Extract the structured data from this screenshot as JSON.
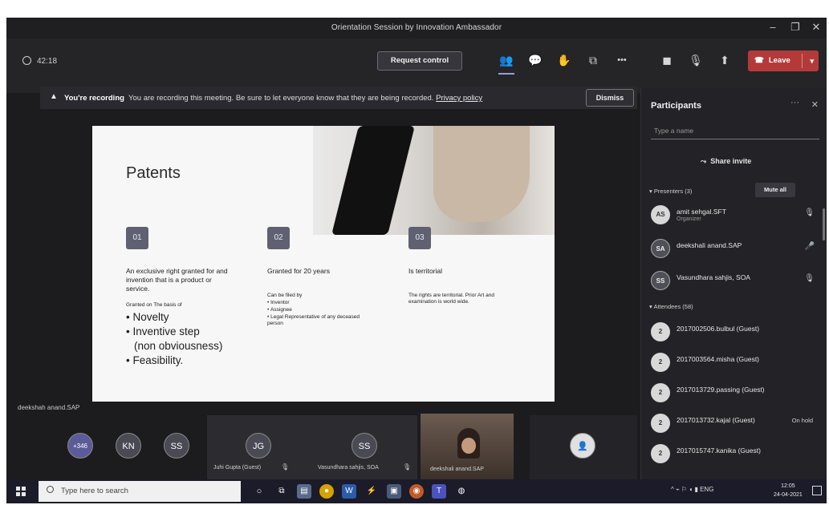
{
  "window": {
    "title": "Orientation Session by Innovation Ambassador"
  },
  "toolbar": {
    "timer": "42:18",
    "request_control": "Request control",
    "leave": "Leave",
    "more": "•••"
  },
  "banner": {
    "bold": "You're recording",
    "text": "You are recording this meeting. Be sure to let everyone know that they are being recorded.",
    "link": "Privacy policy",
    "dismiss": "Dismiss"
  },
  "slide": {
    "title": "Patents",
    "columns": [
      {
        "num": "01",
        "heading": "An exclusive right granted for and invention that is a product or service.",
        "sub": "Granted on The basis of",
        "bullets": [
          "Novelty",
          "Inventive step",
          "(non obviousness)",
          "Feasibility."
        ]
      },
      {
        "num": "02",
        "heading": "Granted for 20 years",
        "sub": "Can be filed by",
        "bullets": [
          "Inventor",
          "Assignee",
          "Legal Representative of any deceased person"
        ]
      },
      {
        "num": "03",
        "heading": "Is territorial",
        "sub": "The rights are territorial. Prior Art and examination is world wide.",
        "bullets": []
      }
    ]
  },
  "presenter_label": "deekshah anand.SAP",
  "strip": {
    "overflow": "+346",
    "avatars": [
      "KN",
      "SS"
    ],
    "tiles": [
      {
        "initials": "JG",
        "name": "Juhi Gupta (Guest)"
      },
      {
        "initials": "SS",
        "name": "Vasundhara sahjis, SOA"
      },
      {
        "name": "deekshali anand.SAP"
      }
    ]
  },
  "panel": {
    "title": "Participants",
    "search_placeholder": "Type a name",
    "share_invite": "Share invite",
    "presenters_head": "Presenters (3)",
    "mute_all": "Mute all",
    "attendees_head": "Attendees (58)",
    "presenters": [
      {
        "initials": "AS",
        "name": "amit sehgal.SFT",
        "role": "Organizer"
      },
      {
        "initials": "SA",
        "name": "deekshali anand.SAP",
        "role": ""
      },
      {
        "initials": "SS",
        "name": "Vasundhara sahjis, SOA",
        "role": ""
      }
    ],
    "attendees": [
      {
        "initials": "2",
        "name": "2017002506.bulbul (Guest)",
        "status": ""
      },
      {
        "initials": "2",
        "name": "2017003564.misha (Guest)",
        "status": ""
      },
      {
        "initials": "2",
        "name": "2017013729.passing (Guest)",
        "status": ""
      },
      {
        "initials": "2",
        "name": "2017013732.kajal (Guest)",
        "status": "On hold"
      },
      {
        "initials": "2",
        "name": "2017015747.kanika (Guest)",
        "status": ""
      }
    ]
  },
  "taskbar": {
    "search_placeholder": "Type here to search",
    "tray": "^ ⌁ ⚐ ◖ ▮ ENG",
    "time": "12:05",
    "date": "24-04-2021"
  }
}
